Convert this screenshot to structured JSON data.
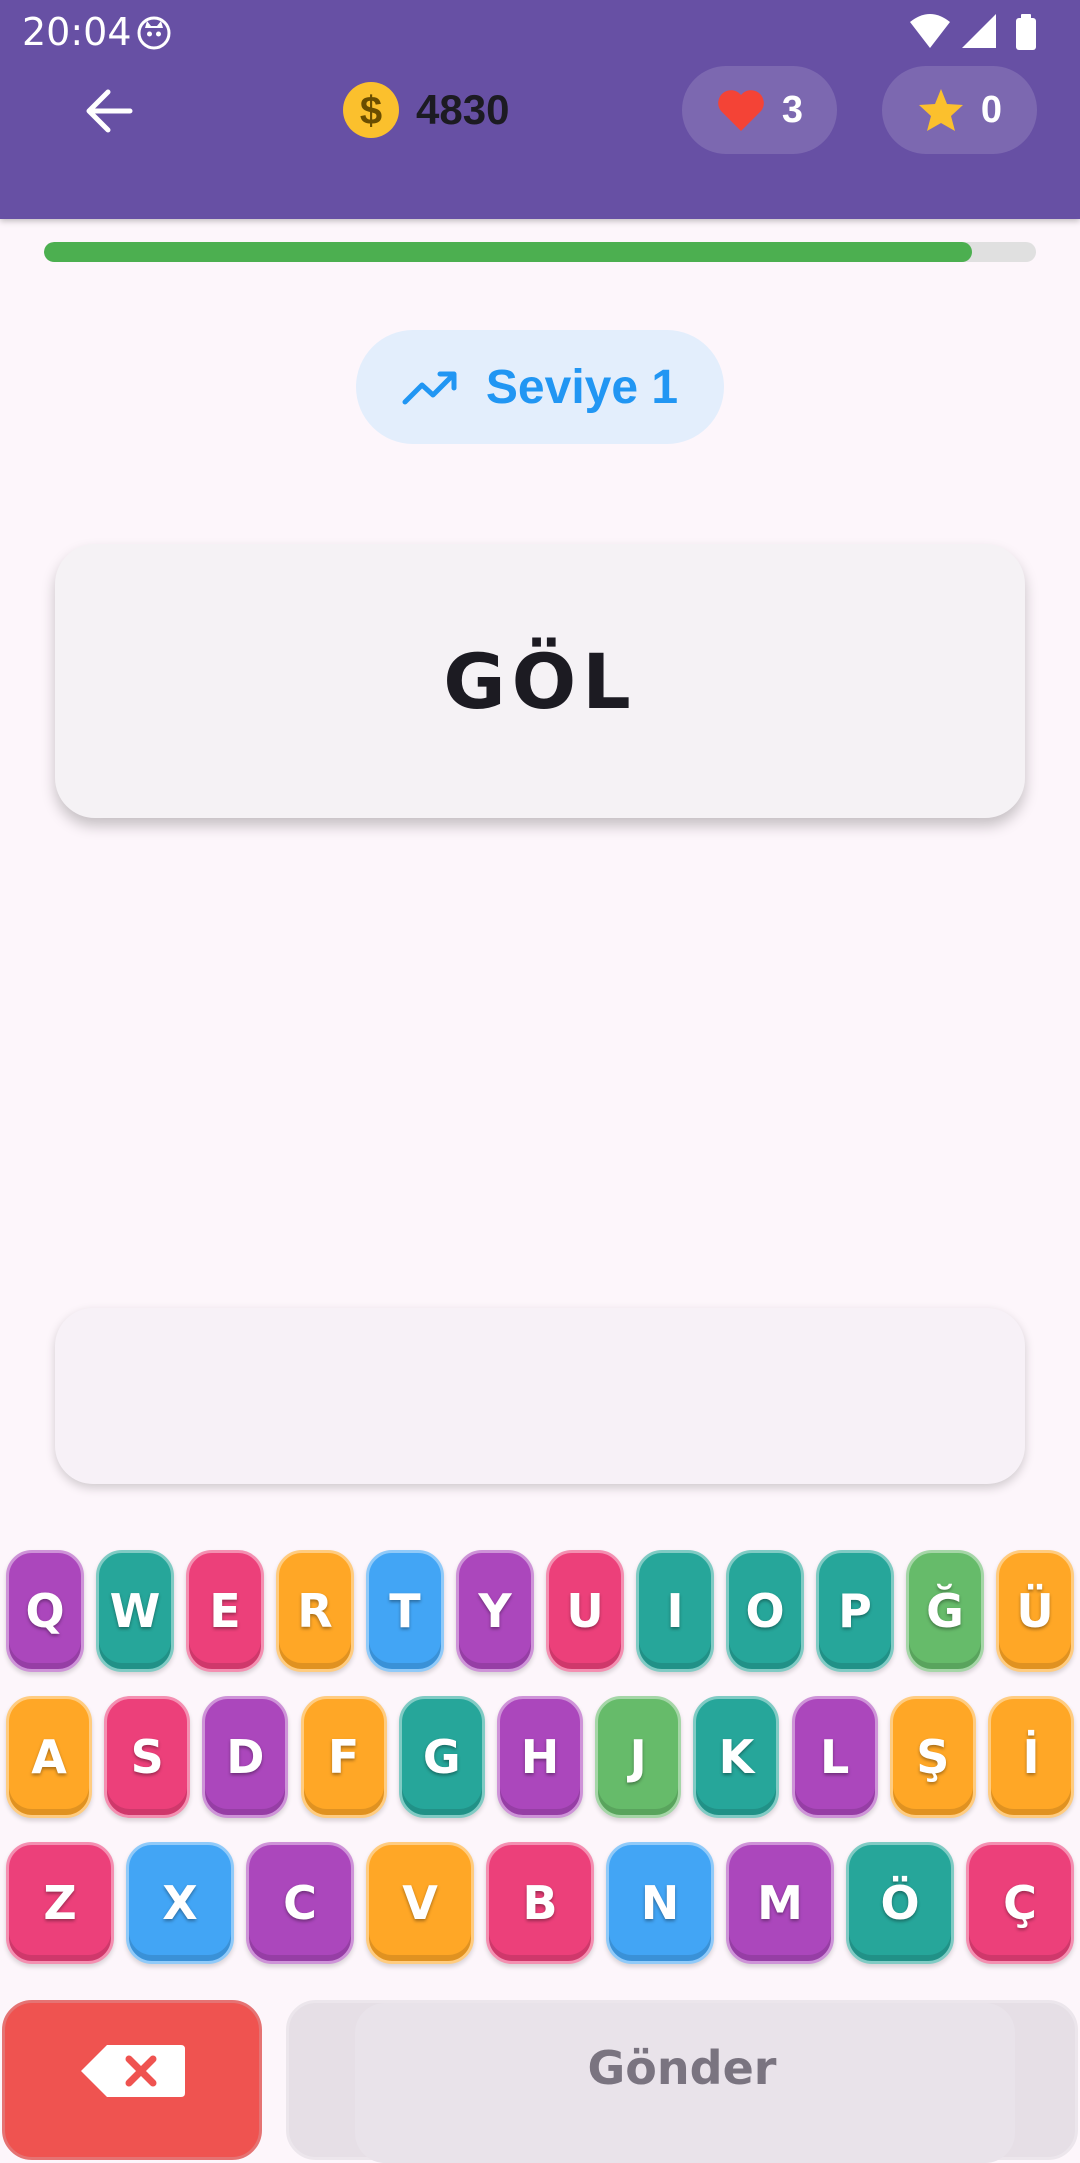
{
  "status_bar": {
    "time": "20:04"
  },
  "header": {
    "coins": "4830",
    "lives": "3",
    "stars": "0",
    "icons": {
      "back": "arrow-left-icon",
      "coin": "dollar-coin-icon",
      "lives": "heart-icon",
      "stars": "star-icon"
    }
  },
  "progress": {
    "fraction": 0.935,
    "color": "#4caf50"
  },
  "level": {
    "label": "Seviye 1",
    "icon": "trending-up-icon"
  },
  "word": "GÖL",
  "answer": "",
  "keyboard": {
    "rows": [
      [
        {
          "k": "Q",
          "c": "purple"
        },
        {
          "k": "W",
          "c": "teal"
        },
        {
          "k": "E",
          "c": "pink"
        },
        {
          "k": "R",
          "c": "orange"
        },
        {
          "k": "T",
          "c": "blue"
        },
        {
          "k": "Y",
          "c": "purple"
        },
        {
          "k": "U",
          "c": "pink"
        },
        {
          "k": "I",
          "c": "teal"
        },
        {
          "k": "O",
          "c": "teal"
        },
        {
          "k": "P",
          "c": "teal"
        },
        {
          "k": "Ğ",
          "c": "green"
        },
        {
          "k": "Ü",
          "c": "orange"
        }
      ],
      [
        {
          "k": "A",
          "c": "orange"
        },
        {
          "k": "S",
          "c": "pink"
        },
        {
          "k": "D",
          "c": "purple"
        },
        {
          "k": "F",
          "c": "orange"
        },
        {
          "k": "G",
          "c": "teal"
        },
        {
          "k": "H",
          "c": "purple"
        },
        {
          "k": "J",
          "c": "green"
        },
        {
          "k": "K",
          "c": "teal"
        },
        {
          "k": "L",
          "c": "purple"
        },
        {
          "k": "Ş",
          "c": "orange"
        },
        {
          "k": "İ",
          "c": "orange"
        }
      ],
      [
        {
          "k": "Z",
          "c": "pink"
        },
        {
          "k": "X",
          "c": "blue"
        },
        {
          "k": "C",
          "c": "purple"
        },
        {
          "k": "V",
          "c": "orange"
        },
        {
          "k": "B",
          "c": "pink"
        },
        {
          "k": "N",
          "c": "blue"
        },
        {
          "k": "M",
          "c": "purple"
        },
        {
          "k": "Ö",
          "c": "teal"
        },
        {
          "k": "Ç",
          "c": "pink"
        }
      ]
    ],
    "delete_icon": "backspace-icon",
    "submit_label": "Gönder"
  },
  "colors": {
    "appbar": "#6750a4",
    "level_text": "#2196f3",
    "delete": "#ef5350"
  }
}
